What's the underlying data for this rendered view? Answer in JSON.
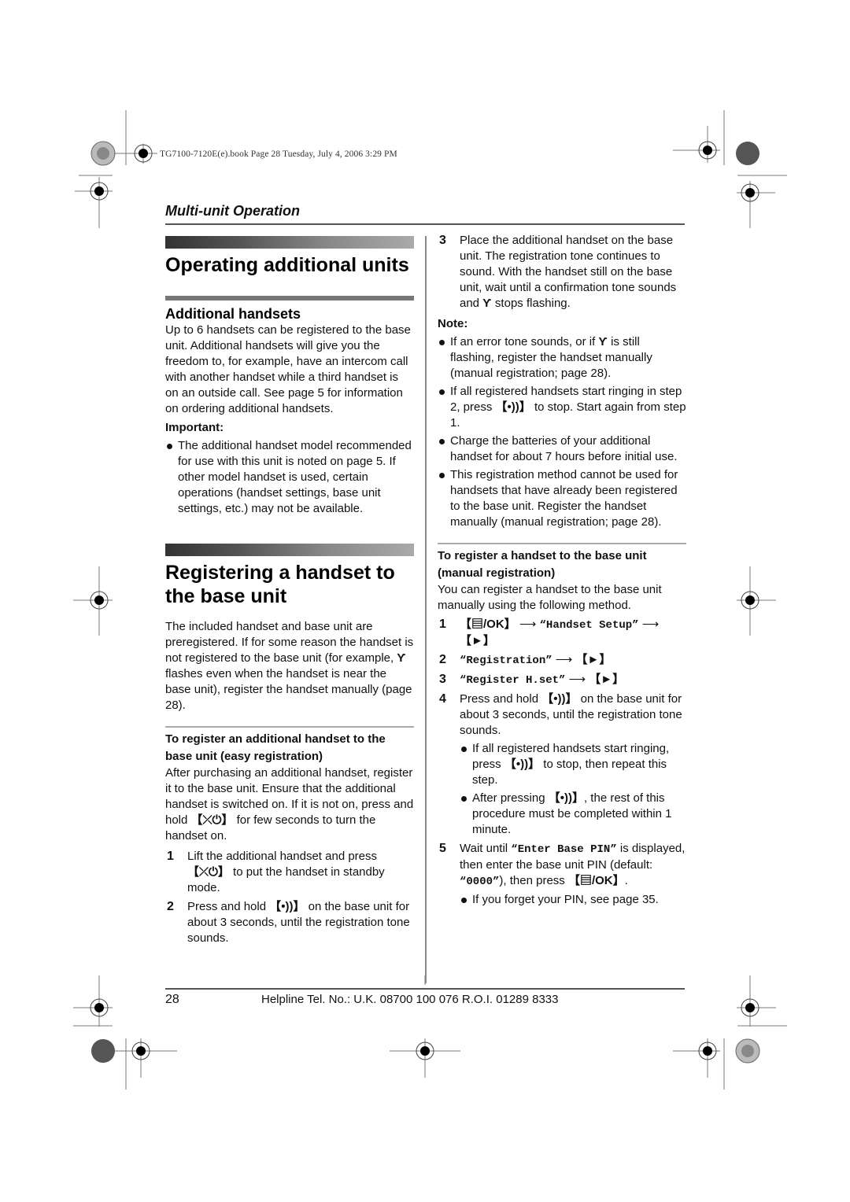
{
  "print_header": "TG7100-7120E(e).book  Page 28  Tuesday, July 4, 2006  3:29 PM",
  "chapter_title": "Multi-unit Operation",
  "left": {
    "section1_title": "Operating additional units",
    "subsection1_title": "Additional handsets",
    "subsection1_text": "Up to 6 handsets can be registered to the base unit. Additional handsets will give you the freedom to, for example, have an intercom call with another handset while a third handset is on an outside call. See page 5 for information on ordering additional handsets.",
    "important_label": "Important:",
    "important_bullets": [
      "The additional handset model recommended for use with this unit is noted on page 5. If other model handset is used, certain operations (handset settings, base unit settings, etc.) may not be available."
    ],
    "section2_title": "Registering a handset to the base unit",
    "section2_text_a": "The included handset and base unit are preregistered. If for some reason the handset is not registered to the base unit (for example, ",
    "section2_text_b": " flashes even when the handset is near the base unit), register the handset manually (page 28).",
    "easy_title": "To register an additional handset to the base unit (easy registration)",
    "easy_text_a": "After purchasing an additional handset, register it to the base unit. Ensure that the additional handset is switched on. If it is not on, press and hold ",
    "easy_text_key": "【⤫⏻】",
    "easy_text_b": " for few seconds to turn the handset on.",
    "steps": [
      {
        "num": "1",
        "text_a": "Lift the additional handset and press ",
        "key": "【⤫⏻】",
        "text_b": " to put the handset in standby mode."
      },
      {
        "num": "2",
        "text_a": "Press and hold ",
        "key": "【•))】",
        "text_b": " on the base unit for about 3 seconds, until the registration tone sounds."
      }
    ]
  },
  "right": {
    "step3_num": "3",
    "step3_text_a": "Place the additional handset on the base unit. The registration tone continues to sound. With the handset still on the base unit, wait until a confirmation tone sounds and ",
    "step3_text_b": " stops flashing.",
    "note_label": "Note:",
    "note1_a": "If an error tone sounds, or if ",
    "note1_b": " is still flashing, register the handset manually (manual registration; page 28).",
    "note2_a": "If all registered handsets start ringing in step 2, press ",
    "note2_key": "【•))】",
    "note2_b": " to stop. Start again from step 1.",
    "note3": "Charge the batteries of your additional handset for about 7 hours before initial use.",
    "note4": "This registration method cannot be used for handsets that have already been registered to the base unit. Register the handset manually (manual registration; page 28).",
    "manual_title": "To register a handset to the base unit (manual registration)",
    "manual_text": "You can register a handset to the base unit manually using the following method.",
    "m_step1_num": "1",
    "m_step1_key": "【▤/OK】",
    "m_step1_arrow": "⟶",
    "m_step1_item": "“Handset Setup”",
    "m_step1_key2": "【►】",
    "m_step2_num": "2",
    "m_step2_item": "“Registration”",
    "m_step3_num": "3",
    "m_step3_item": "“Register H.set”",
    "m_step4_num": "4",
    "m_step4_a": "Press and hold ",
    "m_step4_key": "【•))】",
    "m_step4_b": " on the base unit for about 3 seconds, until the registration tone sounds.",
    "m_step4_bullet1_a": "If all registered handsets start ringing, press ",
    "m_step4_bullet1_b": " to stop, then repeat this step.",
    "m_step4_bullet2_a": "After pressing ",
    "m_step4_bullet2_b": ", the rest of this procedure must be completed within 1 minute.",
    "m_step5_num": "5",
    "m_step5_a": "Wait until ",
    "m_step5_item": "“Enter Base PIN”",
    "m_step5_b": " is displayed, then enter the base unit PIN (default: ",
    "m_step5_pin": "“0000”",
    "m_step5_c": "), then press ",
    "m_step5_key": "【▤/OK】",
    "m_step5_d": ".",
    "m_step5_bullet": "If you forget your PIN, see page 35."
  },
  "antenna_icon": "Ƴ",
  "footer": {
    "page_number": "28",
    "helpline": "Helpline Tel. No.: U.K. 08700 100 076  R.O.I. 01289 8333"
  }
}
